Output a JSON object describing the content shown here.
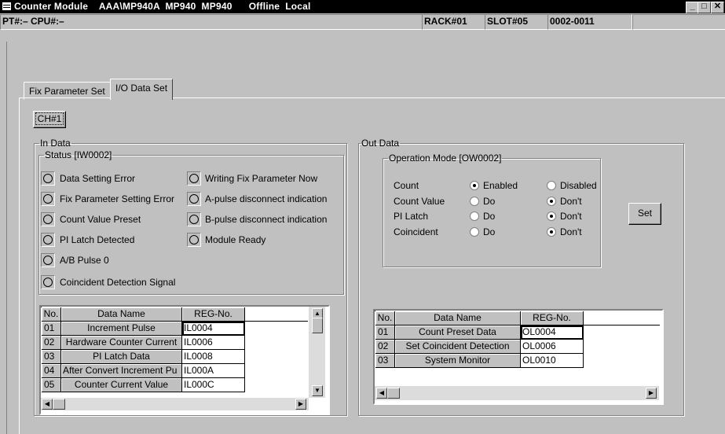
{
  "window": {
    "title": "Counter Module    AAA\\MP940A  MP940  MP940      Offline  Local",
    "minimize": "_",
    "maximize": "□",
    "close": "✕"
  },
  "status_bar": {
    "left": "PT#:– CPU#:–",
    "rack": "RACK#01",
    "slot": "SLOT#05",
    "range": "0002-0011"
  },
  "tabs": [
    "Fix Parameter Set",
    "I/O Data Set"
  ],
  "active_tab": 1,
  "channel_button": "CH#1",
  "in_data": {
    "title": "In Data",
    "status_title": "Status [IW0002]",
    "indicators_left": [
      "Data Setting Error",
      "Fix Parameter Setting Error",
      "Count Value Preset",
      "PI Latch Detected",
      "A/B Pulse 0",
      "Coincident Detection Signal"
    ],
    "indicators_right": [
      "Writing Fix Parameter Now",
      "A-pulse disconnect indication",
      "B-pulse disconnect indication",
      "Module Ready"
    ],
    "table": {
      "headers": [
        "No.",
        "Data Name",
        "REG-No."
      ],
      "rows": [
        [
          "01",
          "Increment Pulse",
          "IL0004"
        ],
        [
          "02",
          "Hardware Counter Current",
          "IL0006"
        ],
        [
          "03",
          "PI Latch Data",
          "IL0008"
        ],
        [
          "04",
          "After Convert Increment Pu",
          "IL000A"
        ],
        [
          "05",
          "Counter Current Value",
          "IL000C"
        ]
      ],
      "selected_row": 0
    }
  },
  "out_data": {
    "title": "Out Data",
    "op_mode_title": "Operation Mode [OW0002]",
    "rows": [
      {
        "label": "Count",
        "opt1": "Enabled",
        "opt2": "Disabled",
        "selected": 1
      },
      {
        "label": "Count Value",
        "opt1": "Do",
        "opt2": "Don't",
        "selected": 2
      },
      {
        "label": "PI Latch",
        "opt1": "Do",
        "opt2": "Don't",
        "selected": 2
      },
      {
        "label": "Coincident",
        "opt1": "Do",
        "opt2": "Don't",
        "selected": 2
      }
    ],
    "set_button": "Set",
    "table": {
      "headers": [
        "No.",
        "Data Name",
        "REG-No."
      ],
      "rows": [
        [
          "01",
          "Count Preset Data",
          "OL0004"
        ],
        [
          "02",
          "Set Coincident Detection",
          "OL0006"
        ],
        [
          "03",
          "System Monitor",
          "OL0010"
        ]
      ],
      "selected_row": 0
    }
  }
}
